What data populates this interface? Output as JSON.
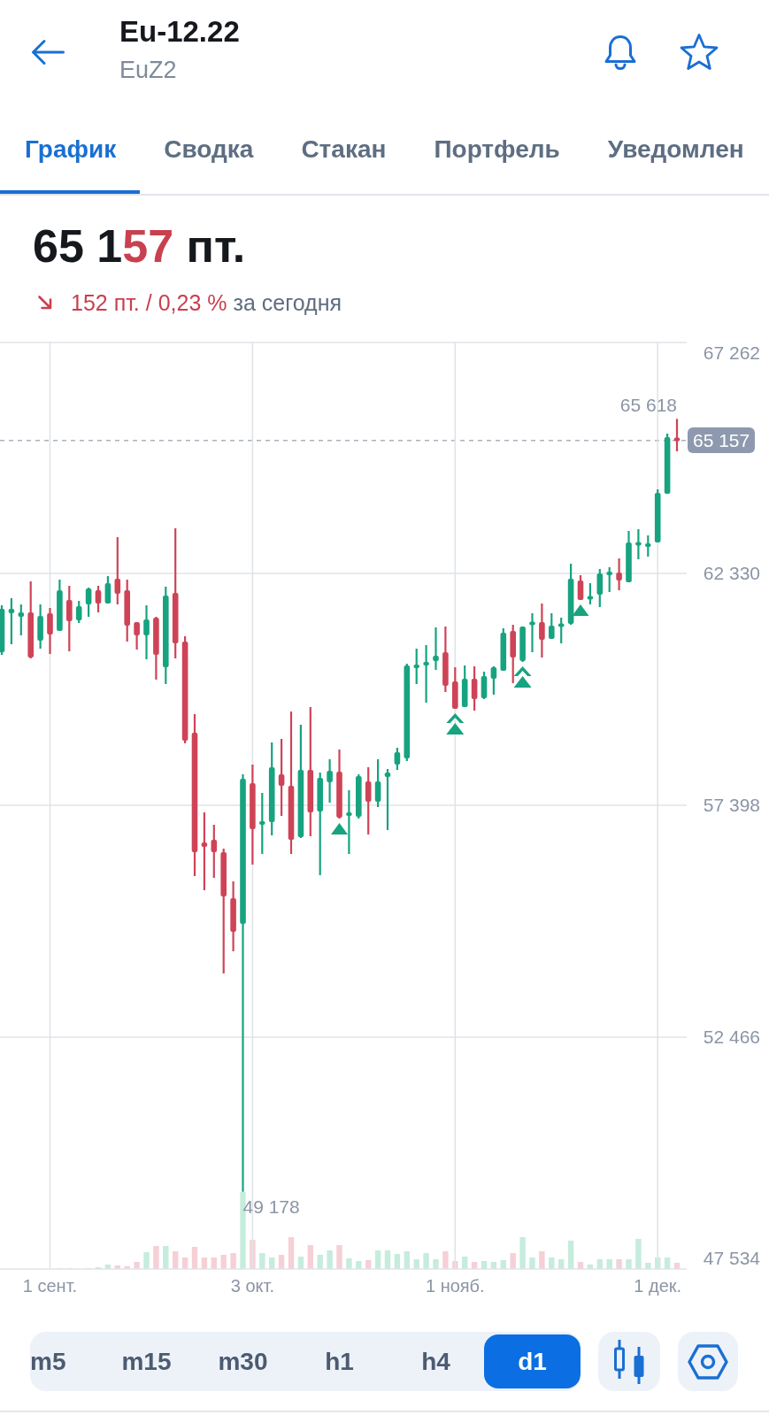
{
  "header": {
    "title": "Eu-12.22",
    "ticker": "EuZ2"
  },
  "tabs": [
    {
      "label": "График",
      "selected": true
    },
    {
      "label": "Сводка",
      "selected": false
    },
    {
      "label": "Стакан",
      "selected": false
    },
    {
      "label": "Портфель",
      "selected": false
    },
    {
      "label": "Уведомлен",
      "selected": false
    }
  ],
  "quote": {
    "price_start": "65 1",
    "price_changed": "57",
    "unit": "пт.",
    "change": {
      "negative": true,
      "amount": "152 пт. / 0,23 %",
      "period": "за сегодня"
    }
  },
  "chart": {
    "high_label": "65 618",
    "low_label": "49 178",
    "last_price_label": "65 157",
    "chart_data": {
      "type": "candlestick",
      "grid": true,
      "categories": [
        null,
        null,
        null,
        null,
        null,
        "1 сент.",
        null,
        null,
        null,
        null,
        null,
        null,
        null,
        null,
        null,
        null,
        null,
        null,
        null,
        null,
        null,
        null,
        null,
        null,
        null,
        null,
        "3 окт.",
        null,
        null,
        null,
        null,
        null,
        null,
        null,
        null,
        null,
        null,
        null,
        null,
        null,
        null,
        null,
        null,
        null,
        null,
        null,
        null,
        "1 нояб.",
        null,
        null,
        null,
        null,
        null,
        null,
        null,
        null,
        null,
        null,
        null,
        null,
        null,
        null,
        null,
        null,
        null,
        null,
        null,
        null,
        "1 дек.",
        null,
        null
      ],
      "ohlc": [
        [
          60655,
          61652,
          60598,
          61577
        ],
        [
          61483,
          61803,
          60824,
          61577
        ],
        [
          61408,
          61671,
          61012,
          61502
        ],
        [
          61502,
          62161,
          60523,
          60542
        ],
        [
          60899,
          61671,
          60730,
          61426
        ],
        [
          61483,
          61596,
          60617,
          61031
        ],
        [
          61106,
          62198,
          61106,
          61972
        ],
        [
          61765,
          62066,
          60673,
          61313
        ],
        [
          61332,
          61746,
          61276,
          61634
        ],
        [
          61671,
          62029,
          61408,
          62010
        ],
        [
          61972,
          62066,
          61502,
          61690
        ],
        [
          61690,
          62274,
          61690,
          62123
        ],
        [
          62217,
          63102,
          61671,
          61897
        ],
        [
          61972,
          62198,
          60881,
          61219
        ],
        [
          61295,
          61295,
          60711,
          61012
        ],
        [
          61012,
          61652,
          60504,
          61351
        ],
        [
          61389,
          61408,
          60071,
          60598
        ],
        [
          60335,
          62048,
          59977,
          61859
        ],
        [
          61916,
          63290,
          60523,
          60843
        ],
        [
          60881,
          60993,
          58716,
          58772
        ],
        [
          58942,
          59337,
          55892,
          56400
        ],
        [
          56607,
          57247,
          55591,
          56513
        ],
        [
          56664,
          56984,
          55854,
          56400
        ],
        [
          56400,
          56476,
          53821,
          55459
        ],
        [
          55421,
          55779,
          54292,
          54706
        ],
        [
          54876,
          58057,
          49178,
          57963
        ],
        [
          57869,
          58264,
          56137,
          56890
        ],
        [
          56984,
          57662,
          56363,
          57059
        ],
        [
          57040,
          58735,
          56758,
          58207
        ],
        [
          58057,
          58810,
          57172,
          57812
        ],
        [
          57812,
          59393,
          56363,
          56664
        ],
        [
          56720,
          59111,
          56701,
          58151
        ],
        [
          58151,
          59488,
          56739,
          57247
        ],
        [
          57266,
          58094,
          55911,
          57982
        ],
        [
          57887,
          58377,
          57454,
          58132
        ],
        [
          58113,
          58584,
          57116,
          57134
        ],
        [
          57172,
          57718,
          56363,
          57247
        ],
        [
          57153,
          58057,
          57116,
          58019
        ],
        [
          57906,
          58207,
          56777,
          57473
        ],
        [
          57473,
          58377,
          57360,
          57906
        ],
        [
          58000,
          58170,
          56871,
          58094
        ],
        [
          58264,
          58622,
          58151,
          58528
        ],
        [
          58396,
          60410,
          58339,
          60372
        ],
        [
          60316,
          60730,
          59977,
          60391
        ],
        [
          60372,
          60805,
          59582,
          60448
        ],
        [
          60466,
          61182,
          60278,
          60579
        ],
        [
          60655,
          61201,
          59808,
          59939
        ],
        [
          60033,
          60335,
          59450,
          59450
        ],
        [
          59488,
          60372,
          59488,
          60090
        ],
        [
          60090,
          60353,
          59412,
          59657
        ],
        [
          59676,
          60240,
          59657,
          60146
        ],
        [
          60090,
          60353,
          59751,
          60335
        ],
        [
          60259,
          61163,
          60259,
          61069
        ],
        [
          61106,
          61238,
          59996,
          60542
        ],
        [
          60466,
          61201,
          60448,
          61201
        ],
        [
          61238,
          61483,
          60655,
          61295
        ],
        [
          61295,
          61690,
          60542,
          60918
        ],
        [
          60937,
          61483,
          60937,
          61219
        ],
        [
          61201,
          61389,
          60843,
          61257
        ],
        [
          61257,
          62537,
          61238,
          62217
        ],
        [
          62179,
          62292,
          61765,
          61765
        ],
        [
          61784,
          62123,
          61671,
          61841
        ],
        [
          61878,
          62424,
          61615,
          62330
        ],
        [
          62292,
          62462,
          61935,
          62368
        ],
        [
          62349,
          62650,
          61972,
          62179
        ],
        [
          62142,
          63234,
          62142,
          62989
        ],
        [
          62932,
          63271,
          62631,
          62989
        ],
        [
          62914,
          63139,
          62688,
          62951
        ],
        [
          62989,
          64118,
          62989,
          64043
        ],
        [
          64024,
          65304,
          64024,
          65229
        ],
        [
          65210,
          65618,
          64928,
          65157
        ]
      ],
      "ylim": [
        47534,
        67262
      ],
      "yticks": [
        {
          "value": 67262,
          "label": "67 262"
        },
        {
          "value": 62330,
          "label": "62 330"
        },
        {
          "value": 57398,
          "label": "57 398"
        },
        {
          "value": 52466,
          "label": "52 466"
        },
        {
          "value": 47534,
          "label": "47 534"
        }
      ]
    }
  },
  "intervals": [
    {
      "label": "m5",
      "selected": false
    },
    {
      "label": "m15",
      "selected": false
    },
    {
      "label": "m30",
      "selected": false
    },
    {
      "label": "h1",
      "selected": false
    },
    {
      "label": "h4",
      "selected": false
    },
    {
      "label": "d1",
      "selected": true
    }
  ]
}
